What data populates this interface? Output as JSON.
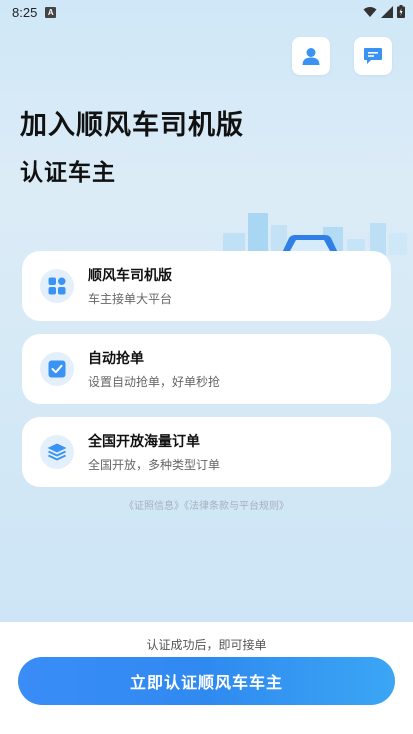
{
  "status_bar": {
    "time": "8:25",
    "notification_icon": "a-icon",
    "icons": [
      "wifi-icon",
      "signal-icon",
      "battery-icon"
    ]
  },
  "header": {
    "profile_icon": "person-icon",
    "message_icon": "chat-icon"
  },
  "hero": {
    "title": "加入顺风车司机版",
    "subtitle": "认证车主"
  },
  "features": [
    {
      "title": "顺风车司机版",
      "desc": "车主接单大平台",
      "icon": "grid-icon"
    },
    {
      "title": "自动抢单",
      "desc": "设置自动抢单，好单秒抢",
      "icon": "checkbox-icon"
    },
    {
      "title": "全国开放海量订单",
      "desc": "全国开放，多种类型订单",
      "icon": "layers-icon"
    }
  ],
  "legal": {
    "text": "《证照信息》《法律条款与平台规则》"
  },
  "footer": {
    "hint": "认证成功后，即可接单",
    "cta_label": "立即认证顺风车车主"
  },
  "colors": {
    "accent": "#2f8af0",
    "icon_blue": "#3a93f2",
    "background_top": "#cfe7f7"
  }
}
